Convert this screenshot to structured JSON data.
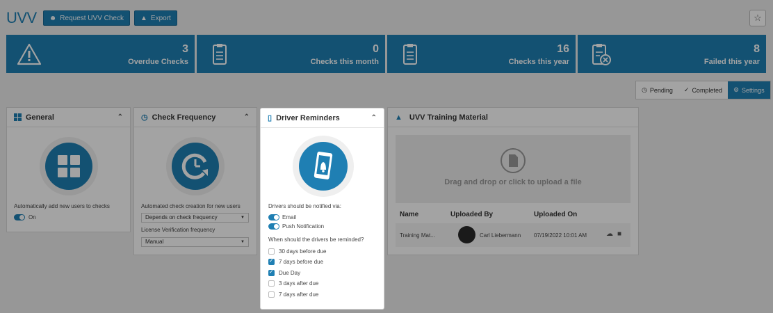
{
  "header": {
    "title": "UVV",
    "request_btn": "Request UVV Check",
    "export_btn": "Export"
  },
  "stats": [
    {
      "value": "3",
      "label": "Overdue Checks",
      "icon": "warning-icon"
    },
    {
      "value": "0",
      "label": "Checks this month",
      "icon": "clipboard-icon"
    },
    {
      "value": "16",
      "label": "Checks this year",
      "icon": "clipboard-icon"
    },
    {
      "value": "8",
      "label": "Failed this year",
      "icon": "clipboard-fail-icon"
    }
  ],
  "tabs": [
    "Pending",
    "Completed",
    "Settings"
  ],
  "general": {
    "title": "General",
    "auto_add_label": "Automatically add new users to checks",
    "toggle_label": "On"
  },
  "frequency": {
    "title": "Check Frequency",
    "auto_label": "Automated check creation for new users",
    "auto_value": "Depends on check frequency",
    "license_label": "License Verification frequency",
    "license_value": "Manual"
  },
  "reminders": {
    "title": "Driver Reminders",
    "notify_label": "Drivers should be notified via:",
    "email": "Email",
    "push": "Push Notification",
    "when_label": "When should the drivers be reminded?",
    "options": [
      {
        "label": "30 days before due",
        "checked": false
      },
      {
        "label": "7 days before due",
        "checked": true
      },
      {
        "label": "Due Day",
        "checked": true
      },
      {
        "label": "3 days after due",
        "checked": false
      },
      {
        "label": "7 days after due",
        "checked": false
      }
    ]
  },
  "training": {
    "title": "UVV Training Material",
    "drop_text": "Drag and drop or click to upload a file",
    "columns": [
      "Name",
      "Uploaded By",
      "Uploaded On"
    ],
    "row": {
      "name": "Training Mat...",
      "by": "Carl Liebermann",
      "on": "07/19/2022 10:01 AM"
    }
  },
  "colors": {
    "accent": "#1f7fb3"
  }
}
